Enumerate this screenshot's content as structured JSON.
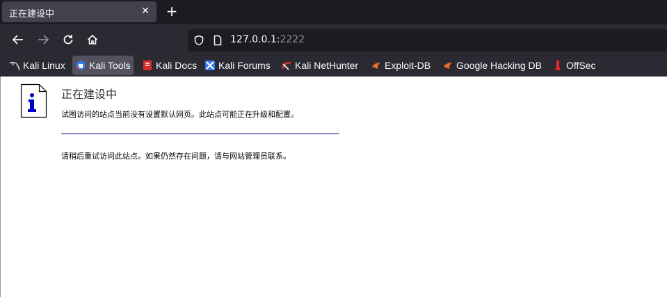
{
  "tab": {
    "title": "正在建设中",
    "close": "✕"
  },
  "newtab": "+",
  "url": {
    "host": "127.0.0.1:",
    "port": "2222"
  },
  "bookmarks": [
    {
      "label": "Kali Linux"
    },
    {
      "label": "Kali Tools"
    },
    {
      "label": "Kali Docs"
    },
    {
      "label": "Kali Forums"
    },
    {
      "label": "Kali NetHunter"
    },
    {
      "label": "Exploit-DB"
    },
    {
      "label": "Google Hacking DB"
    },
    {
      "label": "OffSec"
    }
  ],
  "page": {
    "title": "正在建设中",
    "line1": "试图访问的站点当前没有设置默认网页。此站点可能正在升级和配置。",
    "line2": "请稍后重试访问此站点。如果仍然存在问题，请与网站管理员联系。"
  },
  "colors": {
    "tabbar_bg": "#1c1b22",
    "toolbar_bg": "#2b2a33",
    "divider": "#000080",
    "info_blue": "#0000cc"
  }
}
